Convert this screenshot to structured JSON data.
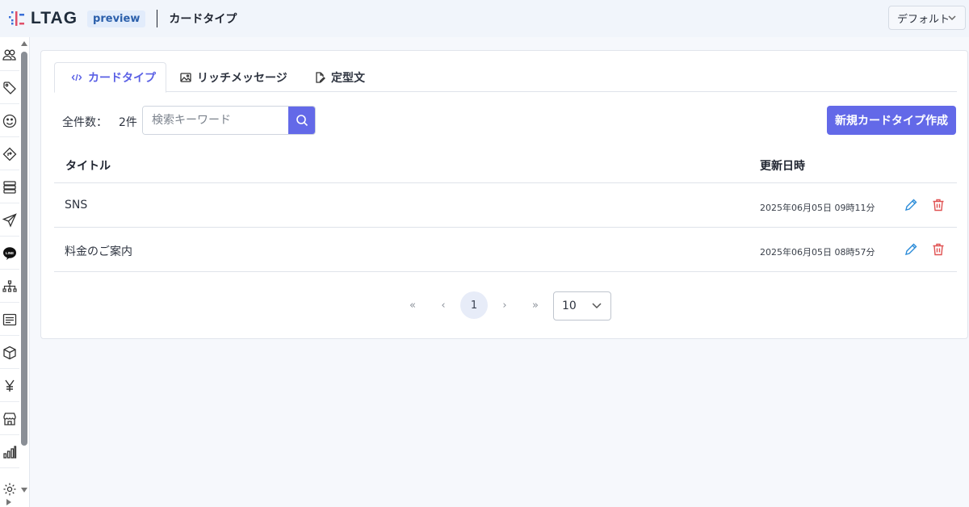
{
  "header": {
    "logo_text": "LTAG",
    "badge": "preview",
    "title": "カードタイプ",
    "workspace": "デフォルト"
  },
  "sidebar": {
    "icons": [
      "users-icon",
      "tag-icon",
      "smile-icon",
      "route-icon",
      "server-icon",
      "send-icon",
      "line-icon",
      "org-chart-icon",
      "list-icon",
      "box-icon",
      "yen-icon",
      "store-icon",
      "bar-chart-icon",
      "gear-icon"
    ]
  },
  "tabs": [
    {
      "label": "カードタイプ",
      "icon": "code-icon",
      "active": true
    },
    {
      "label": "リッチメッセージ",
      "icon": "image-icon",
      "active": false
    },
    {
      "label": "定型文",
      "icon": "document-edit-icon",
      "active": false
    }
  ],
  "toolbar": {
    "count_label": "全件数：",
    "count_value": "2件",
    "search_placeholder": "検索キーワード",
    "create_label": "新規カードタイプ作成"
  },
  "table": {
    "columns": {
      "title": "タイトル",
      "updated": "更新日時"
    },
    "rows": [
      {
        "title": "SNS",
        "updated": "2025年06月05日 09時11分"
      },
      {
        "title": "料金のご案内",
        "updated": "2025年06月05日 08時57分"
      }
    ]
  },
  "pagination": {
    "first": "«",
    "prev": "‹",
    "current": "1",
    "next": "›",
    "last": "»",
    "page_size": "10"
  },
  "colors": {
    "accent": "#6369e8",
    "delete": "#e05252",
    "edit": "#2a8bd8"
  }
}
